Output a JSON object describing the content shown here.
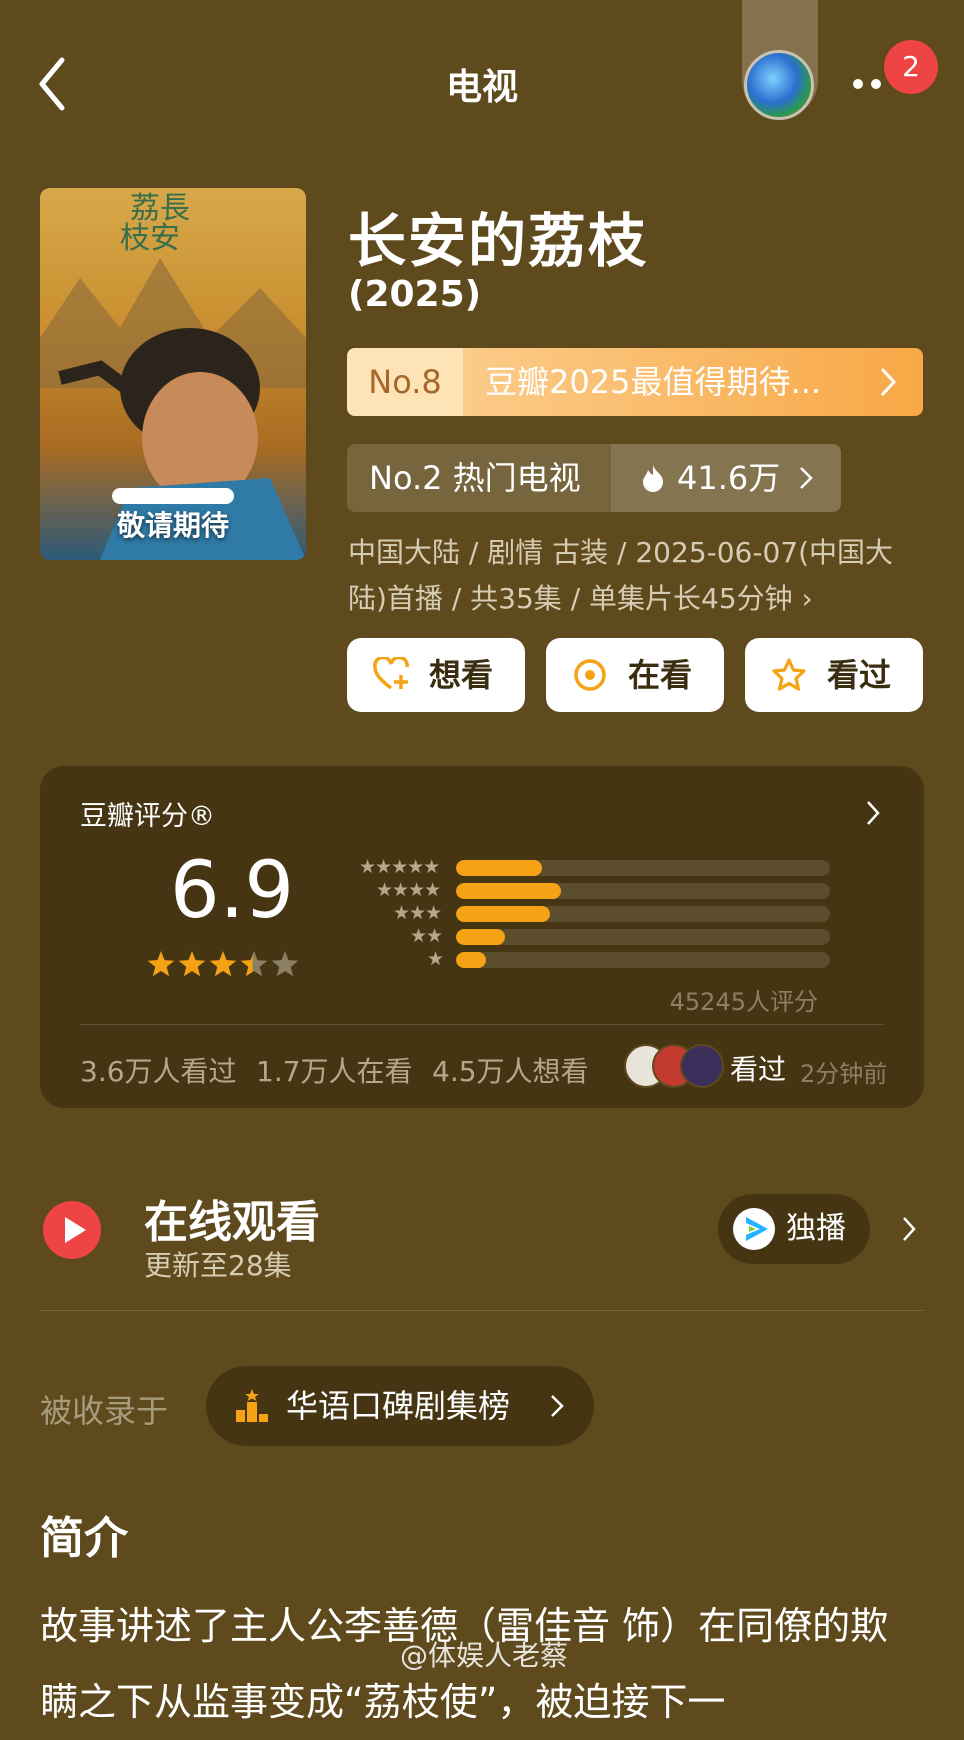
{
  "header": {
    "title": "电视",
    "badge_count": "2"
  },
  "show": {
    "title": "长安的荔枝",
    "year": "(2025)",
    "poster_caption": "敬请期待",
    "rank1_no": "No.8",
    "rank1_text": "豆瓣2025最值得期待...",
    "rank2_no": "No.2 热门电视",
    "rank2_heat": "41.6万",
    "meta": "中国大陆 / 剧情 古装 / 2025-06-07(中国大陆)首播 / 共35集 / 单集片长45分钟 ›"
  },
  "actions": {
    "want": "想看",
    "watching": "在看",
    "watched": "看过"
  },
  "rating": {
    "title": "豆瓣评分®",
    "score": "6.9",
    "star_fraction": 0.69,
    "distribution": [
      {
        "stars": "★★★★★",
        "fraction": 0.23
      },
      {
        "stars": "★★★★",
        "fraction": 0.28
      },
      {
        "stars": "★★★",
        "fraction": 0.25
      },
      {
        "stars": "★★",
        "fraction": 0.13
      },
      {
        "stars": "★",
        "fraction": 0.08
      }
    ],
    "raters": "45245人评分",
    "watched": "3.6万人看过",
    "watching": "1.7万人在看",
    "want": "4.5万人想看",
    "friend_action": "看过",
    "friend_time": "2分钟前"
  },
  "online": {
    "title": "在线观看",
    "subtitle": "更新至28集",
    "exclusive": "独播"
  },
  "included": {
    "label": "被收录于",
    "chart": "华语口碑剧集榜"
  },
  "intro": {
    "title": "简介",
    "text": "故事讲述了主人公李善德（雷佳音 饰）在同僚的欺瞒之下从监事变成“荔枝使”，被迫接下一"
  },
  "watermark": "@体娱人老蔡",
  "colors": {
    "background": "#5e4a1c",
    "accent_orange": "#f5a214",
    "badge_red": "#ee4444"
  }
}
